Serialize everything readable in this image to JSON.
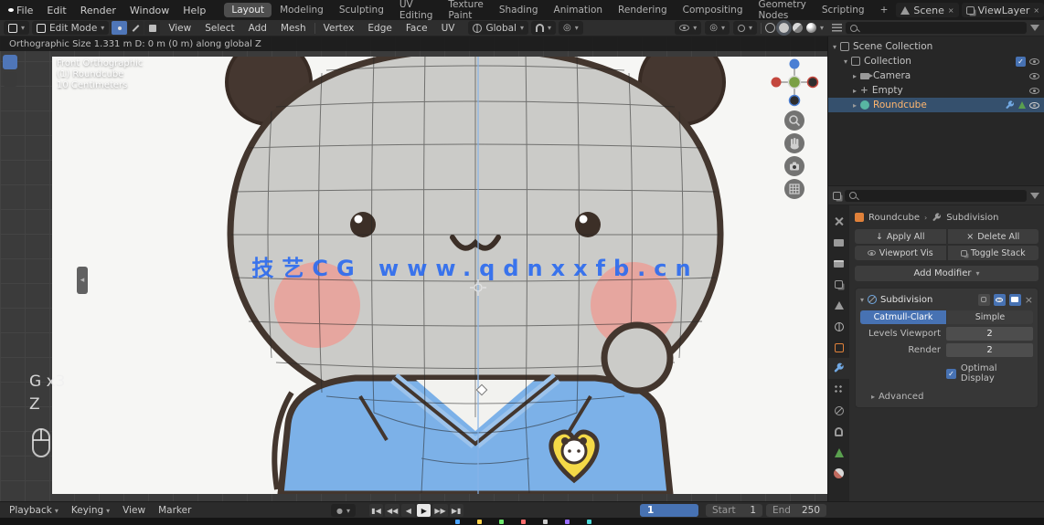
{
  "topbar": {
    "menus": [
      "File",
      "Edit",
      "Render",
      "Window",
      "Help"
    ],
    "workspaces": [
      "Layout",
      "Modeling",
      "Sculpting",
      "UV Editing",
      "Texture Paint",
      "Shading",
      "Animation",
      "Rendering",
      "Compositing",
      "Geometry Nodes",
      "Scripting"
    ],
    "active_workspace": "Layout",
    "scene_name": "Scene",
    "view_layer_name": "ViewLayer"
  },
  "viewport_header": {
    "mode": "Edit Mode",
    "menus": [
      "View",
      "Select",
      "Add",
      "Mesh",
      "Vertex",
      "Edge",
      "Face",
      "UV"
    ],
    "orientation": "Global"
  },
  "operator_status": "Orthographic Size  1.331 m     D: 0 m (0 m)  along global Z",
  "viewport": {
    "view_label": "Front Orthographic",
    "object_label": "(1) Roundcube",
    "scale_label": "10 Centimeters",
    "watermark": "技艺CG www.qdnxxfb.cn",
    "keystroke_1": "G x3",
    "keystroke_2": "Z"
  },
  "outliner": {
    "items": [
      {
        "label": "Scene Collection"
      },
      {
        "label": "Collection"
      },
      {
        "label": "Camera"
      },
      {
        "label": "Empty"
      },
      {
        "label": "Roundcube"
      }
    ]
  },
  "properties": {
    "breadcrumb_object": "Roundcube",
    "breadcrumb_modifier": "Subdivision",
    "modifier_list": {
      "apply_all": "Apply All",
      "delete_all": "Delete All",
      "viewport_vis": "Viewport Vis",
      "toggle_stack": "Toggle Stack",
      "add_modifier": "Add Modifier"
    },
    "subdivision": {
      "name": "Subdivision",
      "algorithm_active": "Catmull-Clark",
      "algorithm_other": "Simple",
      "levels_viewport_label": "Levels Viewport",
      "levels_viewport": "2",
      "render_label": "Render",
      "render": "2",
      "optimal_display_label": "Optimal Display",
      "advanced_label": "Advanced"
    }
  },
  "timeline": {
    "menus": [
      "Playback",
      "Keying",
      "View",
      "Marker"
    ],
    "current_frame": "1",
    "start_label": "Start",
    "start": "1",
    "end_label": "End",
    "end": "250"
  },
  "icons": {
    "chevron_down": "▾",
    "arrow_right": "▸",
    "arrow_down": "▾",
    "chevron_sep": "›",
    "close": "×",
    "check": "✓",
    "plus": "+",
    "collapse_left": "◂",
    "proportional": "◎",
    "empty_axes": "+",
    "down_arrow": "↓",
    "record_dot": "●",
    "transport": {
      "jump_start": "▮◀",
      "prev_key": "◀◀",
      "play_rev": "◀",
      "play": "▶",
      "next_key": "▶▶",
      "jump_end": "▶▮"
    }
  },
  "colors": {
    "accent_blue": "#4772b3",
    "selection_orange": "#ffb66e",
    "watermark_blue": "#2d6cf0",
    "object_orange": "#e0813a"
  }
}
